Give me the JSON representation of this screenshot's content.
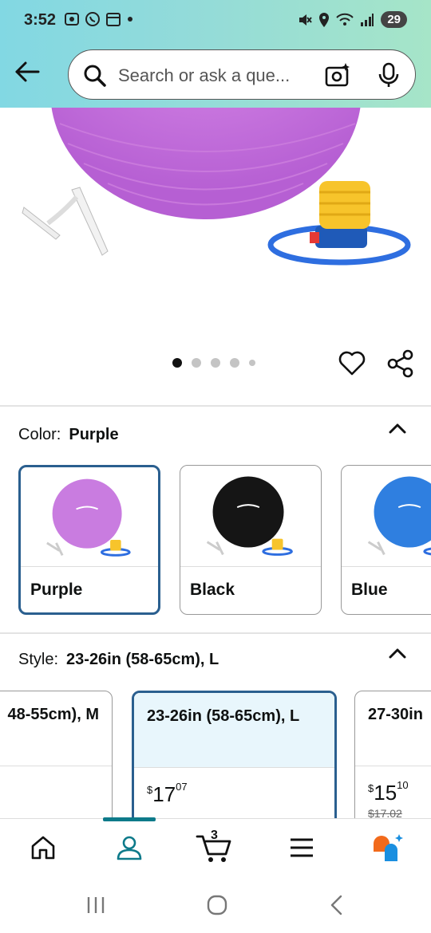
{
  "status_bar": {
    "time": "3:52",
    "battery": "29"
  },
  "search": {
    "placeholder": "Search or ask a que..."
  },
  "gallery": {
    "dots": 5,
    "active_index": 0
  },
  "color_section": {
    "label": "Color:",
    "selected": "Purple",
    "options": [
      {
        "label": "Purple",
        "color": "#c97ce0"
      },
      {
        "label": "Black",
        "color": "#151515"
      },
      {
        "label": "Blue",
        "color": "#2f7fe0"
      }
    ]
  },
  "style_section": {
    "label": "Style:",
    "selected": "23-26in (58-65cm), L",
    "options": [
      {
        "label": "48-55cm), M",
        "price_whole": "",
        "price_frac": "",
        "strike": ""
      },
      {
        "label": "23-26in (58-65cm), L",
        "price_symbol": "$",
        "price_whole": "17",
        "price_frac": "07",
        "strike": ""
      },
      {
        "label": "27-30in",
        "price_symbol": "$",
        "price_whole": "15",
        "price_frac": "10",
        "strike": "$17.02"
      }
    ]
  },
  "bottom_nav": {
    "items": [
      "home",
      "account",
      "cart",
      "menu",
      "rufus"
    ],
    "cart_count": "3",
    "active": "account"
  },
  "colors": {
    "accent": "#2a5f8f",
    "selected_bg": "#e8f6fc",
    "nav_indicator": "#0d7a8a"
  }
}
